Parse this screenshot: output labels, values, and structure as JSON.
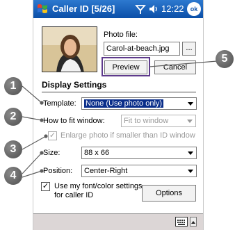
{
  "titlebar": {
    "app_title": "Caller ID [5/26]",
    "clock": "12:22",
    "ok_label": "ok",
    "icons": [
      "windows-start-icon",
      "signal-icon",
      "volume-icon",
      "ok-icon"
    ]
  },
  "photo_section": {
    "photo_file_label": "Photo file:",
    "photo_file_value": "Carol-at-beach.jpg",
    "browse_label": "...",
    "preview_label": "Preview",
    "cancel_label": "Cancel"
  },
  "display_settings": {
    "heading": "Display Settings",
    "template_label": "Template:",
    "template_value": "None (Use photo only)",
    "fit_label": "How to fit window:",
    "fit_value": "Fit to window",
    "enlarge_label": "Enlarge photo if smaller than ID window",
    "enlarge_checked": true,
    "size_label": "Size:",
    "size_value": "88 x 66",
    "position_label": "Position:",
    "position_value": "Center-Right",
    "myfont_label_line1": "Use my font/color settings",
    "myfont_label_line2": "for caller ID",
    "myfont_checked": true,
    "options_label": "Options"
  },
  "callouts": [
    "1",
    "2",
    "3",
    "4",
    "5"
  ],
  "colors": {
    "titlebar": "#0b4fa8",
    "selection": "#0a2e8a",
    "callout": "#5e5e5e",
    "highlight_box": "#5e3a8c",
    "bottom_bar": "#dcd6d6"
  },
  "bottom_bar": {
    "icons": [
      "keyboard-icon",
      "sip-arrow-icon"
    ]
  }
}
